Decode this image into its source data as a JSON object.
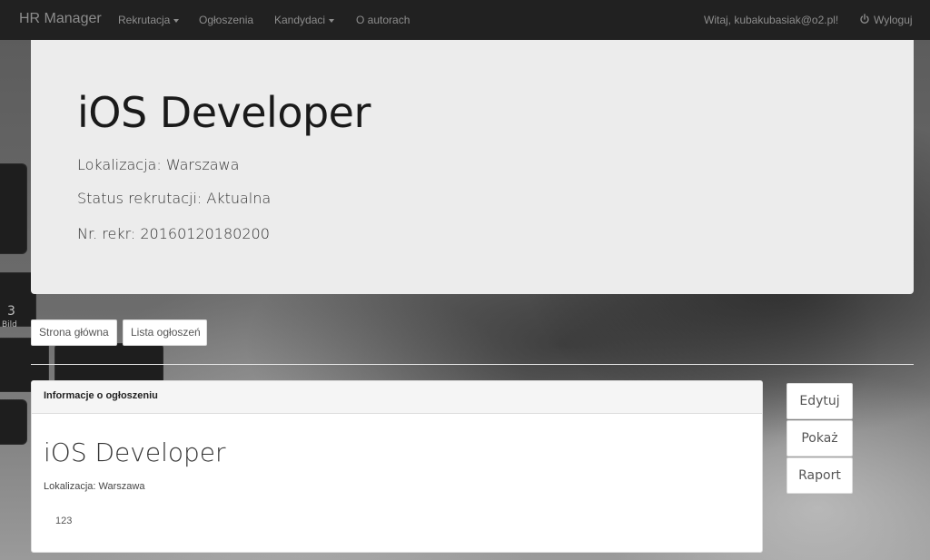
{
  "navbar": {
    "brand": "HR Manager",
    "items": [
      {
        "label": "Rekrutacja",
        "dropdown": true
      },
      {
        "label": "Ogłoszenia",
        "dropdown": false
      },
      {
        "label": "Kandydaci",
        "dropdown": true
      },
      {
        "label": "O autorach",
        "dropdown": false
      }
    ],
    "greeting": "Witaj, kubakubasiak@o2.pl!",
    "logout": "Wyloguj",
    "logout_icon": "power-icon"
  },
  "jumbotron": {
    "title": "iOS Developer",
    "location": "Lokalizacja: Warszawa",
    "status": "Status rekrutacji: Aktualna",
    "number": "Nr. rekr: 20160120180200"
  },
  "breadcrumb_buttons": {
    "home": "Strona główna",
    "list": "Lista ogłoszeń"
  },
  "panel": {
    "heading": "Informacje o ogłoszeniu",
    "title": "iOS Developer",
    "location": "Lokalizacja: Warszawa",
    "body": "123"
  },
  "actions": {
    "edit": "Edytuj",
    "show": "Pokaż",
    "report": "Raport"
  },
  "background_keys": {
    "key_number": "3",
    "key_text": "Bild"
  },
  "colors": {
    "navbar_bg": "#212121",
    "nav_text": "#8d8d8d",
    "jumbotron_bg": "#ececec"
  }
}
